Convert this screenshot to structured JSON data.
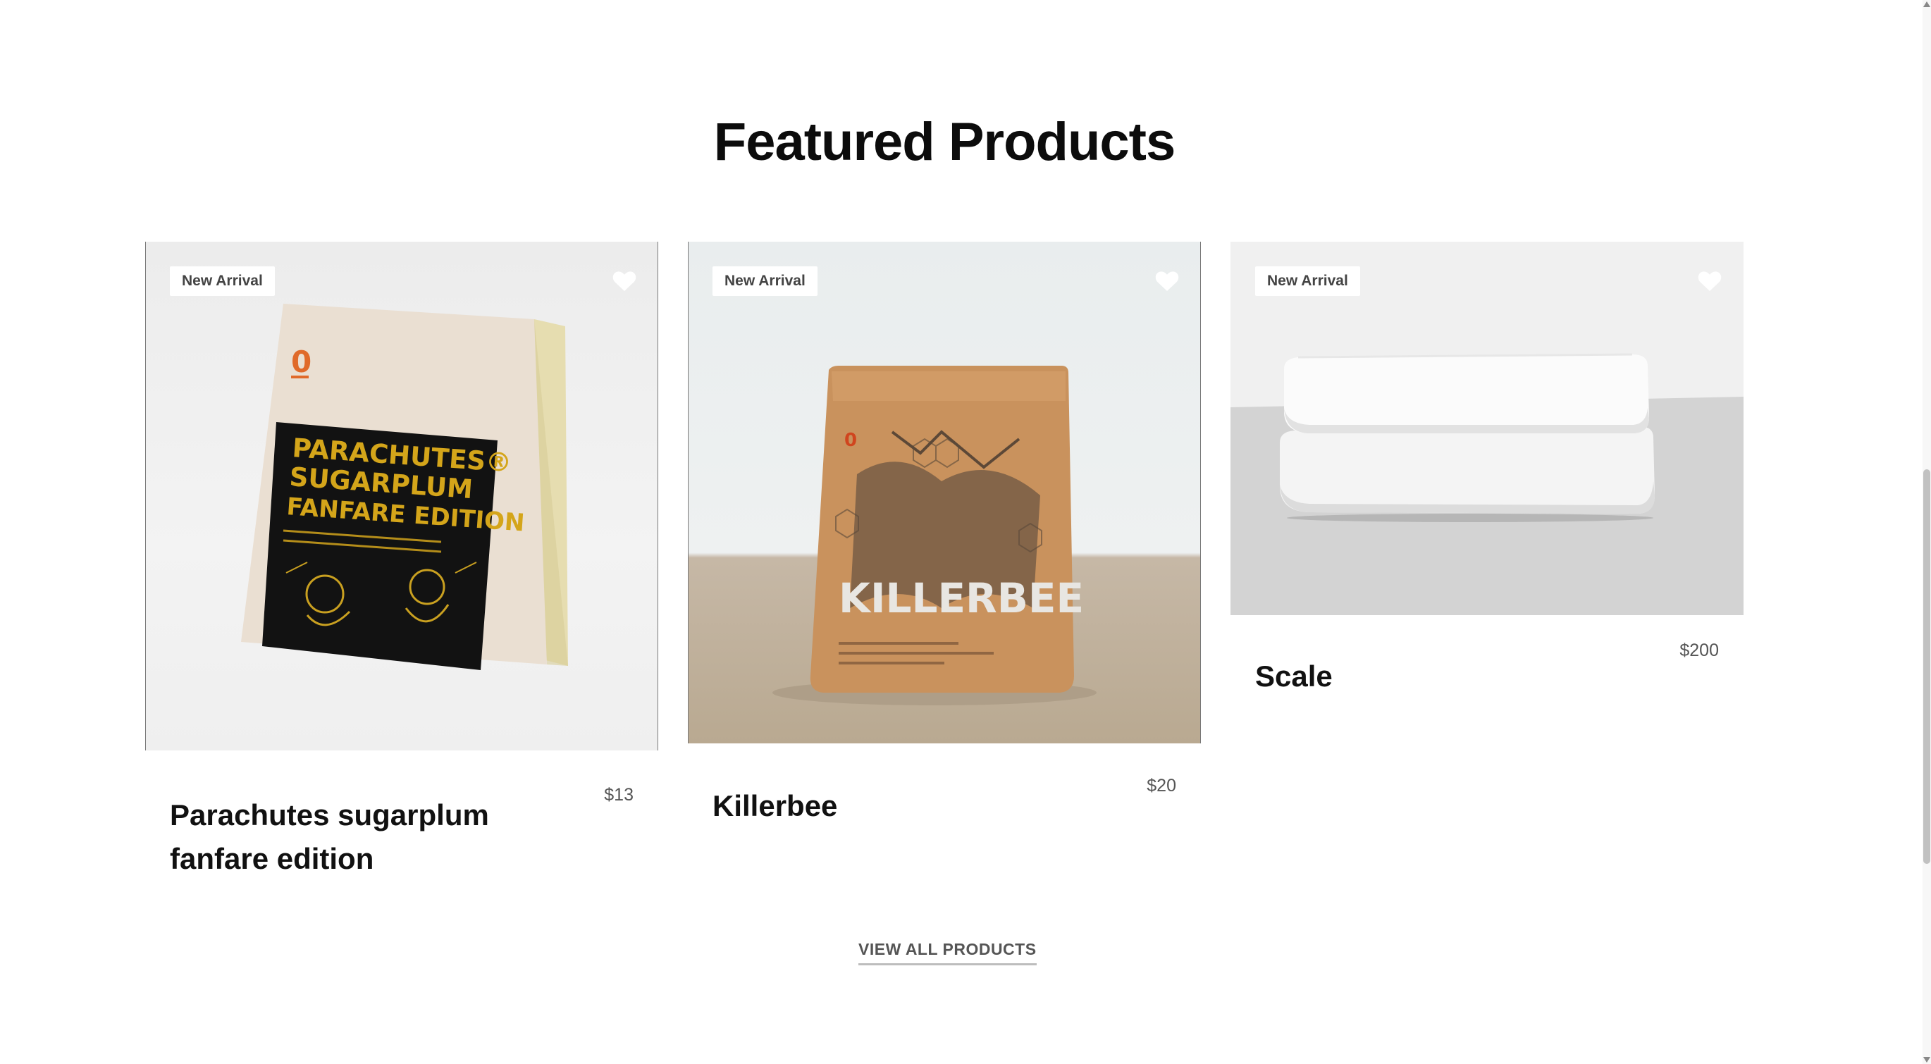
{
  "section": {
    "title": "Featured Products"
  },
  "products": [
    {
      "name": "Parachutes sugarplum fanfare edition",
      "price": "$13",
      "badge": "New Arrival",
      "icon": "heart-icon"
    },
    {
      "name": "Killerbee",
      "price": "$20",
      "badge": "New Arrival",
      "icon": "heart-icon"
    },
    {
      "name": "Scale",
      "price": "$200",
      "badge": "New Arrival",
      "icon": "heart-icon"
    }
  ],
  "packaging": {
    "parachutes": {
      "line1": "PARACHUTES®",
      "line2": "SUGARPLUM",
      "line3": "FANFARE EDITION",
      "logo": "0"
    },
    "killerbee": {
      "label": "KILLERBEE",
      "logo": "0"
    }
  },
  "footer": {
    "view_all_label": "VIEW ALL PRODUCTS"
  },
  "colors": {
    "heading": "#0c0c0c",
    "price": "#555555",
    "badge_bg": "#ffffff",
    "accent_orange": "#e06a2a"
  }
}
